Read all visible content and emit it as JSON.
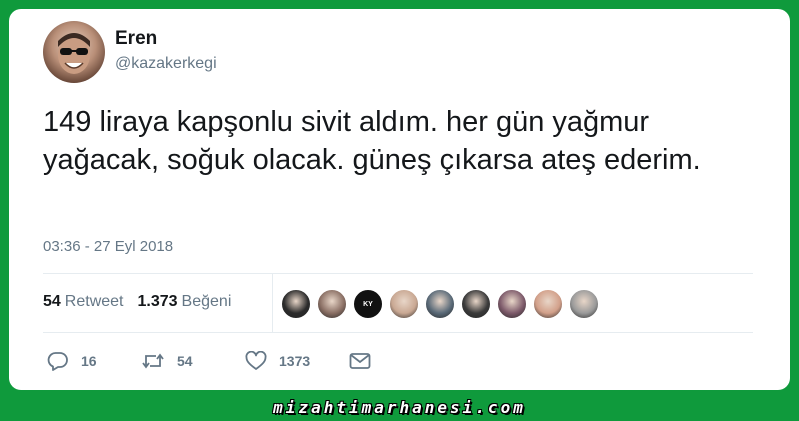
{
  "user": {
    "name": "Eren",
    "handle": "@kazakerkegi"
  },
  "tweet": {
    "text": "149 liraya kapşonlu sivit aldım. her gün yağmur yağacak, soğuk olacak. güneş çıkarsa ateş ederim.",
    "timestamp": "03:36 - 27 Eyl 2018"
  },
  "stats": {
    "retweets_count": "54",
    "retweets_label": "Retweet",
    "likes_count": "1.373",
    "likes_label": "Beğeni"
  },
  "likers": [
    {
      "color": "#2b2b2b",
      "text": ""
    },
    {
      "color": "#8a6f64",
      "text": ""
    },
    {
      "color": "#111111",
      "text": "KY"
    },
    {
      "color": "#c9a893",
      "text": ""
    },
    {
      "color": "#5a6a78",
      "text": ""
    },
    {
      "color": "#3a3a3a",
      "text": ""
    },
    {
      "color": "#7d5a6a",
      "text": ""
    },
    {
      "color": "#d2a08a",
      "text": ""
    },
    {
      "color": "#9a9a9a",
      "text": ""
    }
  ],
  "actions": {
    "reply_count": "16",
    "retweet_count": "54",
    "like_count": "1373"
  },
  "footer": {
    "watermark": "mizahtimarhanesi.com"
  },
  "colors": {
    "background": "#0f9a3c",
    "text_primary": "#14171a",
    "text_secondary": "#657786"
  }
}
